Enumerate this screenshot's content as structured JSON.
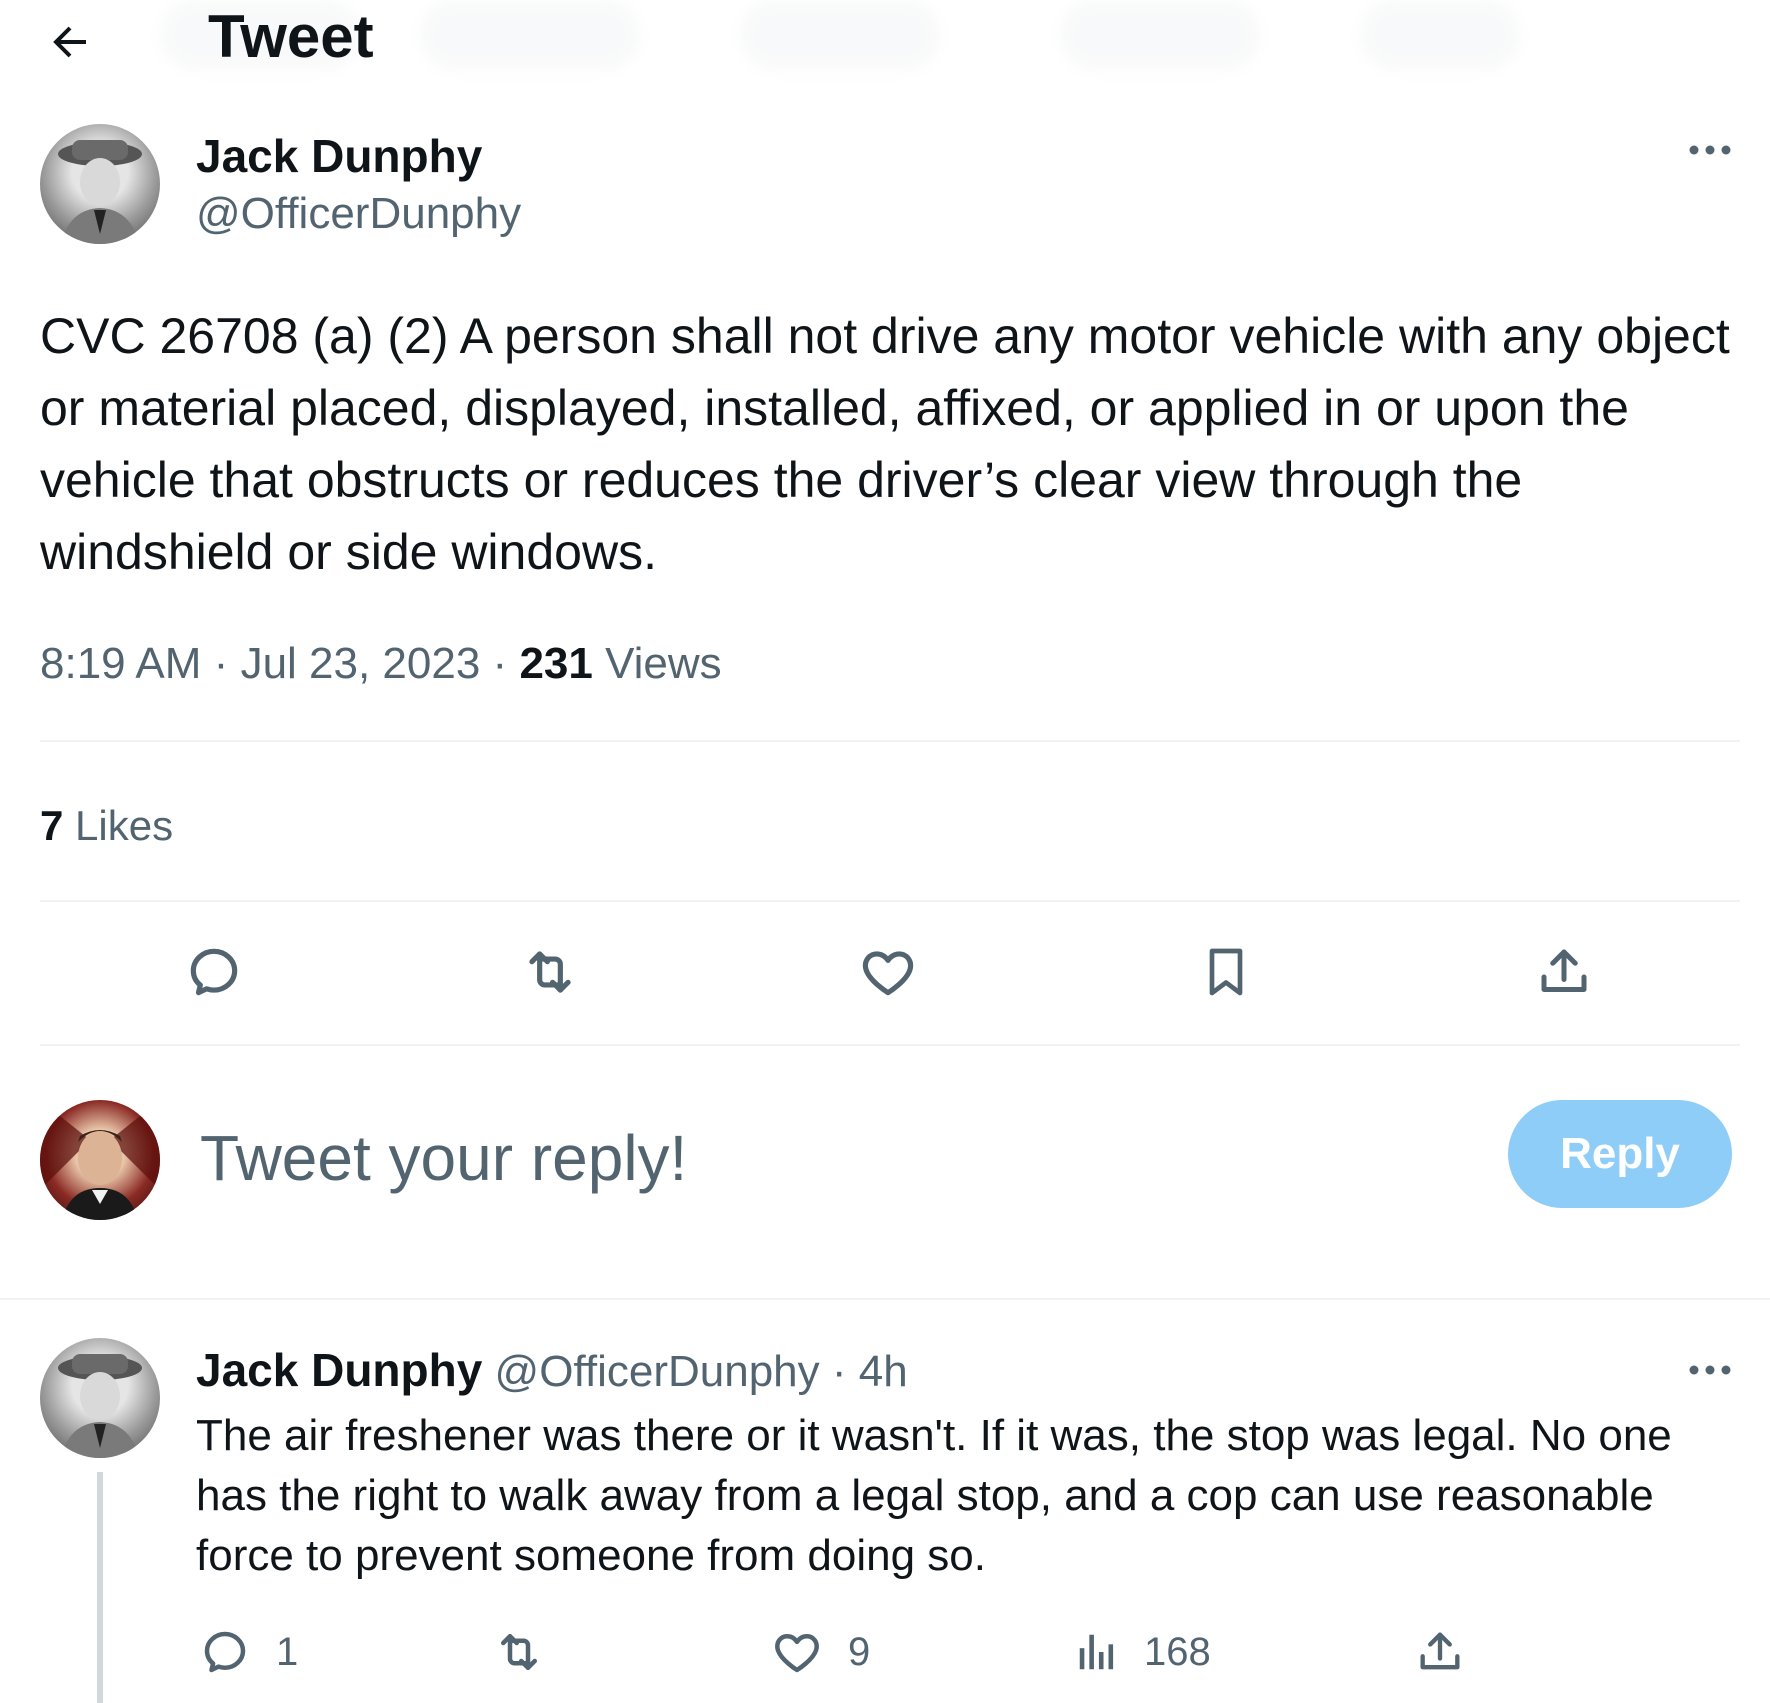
{
  "header": {
    "title": "Tweet"
  },
  "tweet": {
    "author": {
      "name": "Jack Dunphy",
      "handle": "@OfficerDunphy"
    },
    "text": "CVC 26708 (a) (2) A person shall not drive any motor vehicle with any object or material placed, displayed, installed, affixed, or applied in or upon the vehicle that obstructs or reduces the driver’s clear view through the windshield or side windows.",
    "time": "8:19 AM",
    "sep": "·",
    "date": "Jul 23, 2023",
    "views_count": "231",
    "views_label": "Views",
    "likes_count": "7",
    "likes_label": "Likes"
  },
  "compose": {
    "placeholder": "Tweet your reply!",
    "reply_label": "Reply"
  },
  "reply": {
    "author": {
      "name": "Jack Dunphy",
      "handle": "@OfficerDunphy"
    },
    "sep": "·",
    "age": "4h",
    "text": "The air freshener was there or it wasn't. If it was, the stop was legal. No one has the right to walk away from a legal stop, and a cop can use reasonable force to prevent someone from doing so.",
    "stats": {
      "replies": "1",
      "likes": "9",
      "views": "168"
    }
  },
  "colors": {
    "text": "#0f1419",
    "muted": "#536471",
    "divider": "#eff3f4",
    "reply_button_disabled": "#8ecdf7"
  },
  "icons": {
    "back": "arrow-left-icon",
    "more": "more-horizontal-icon",
    "reply": "speech-bubble-icon",
    "retweet": "retweet-icon",
    "like": "heart-icon",
    "bookmark": "bookmark-icon",
    "share": "share-upload-icon",
    "views": "bar-chart-icon"
  }
}
